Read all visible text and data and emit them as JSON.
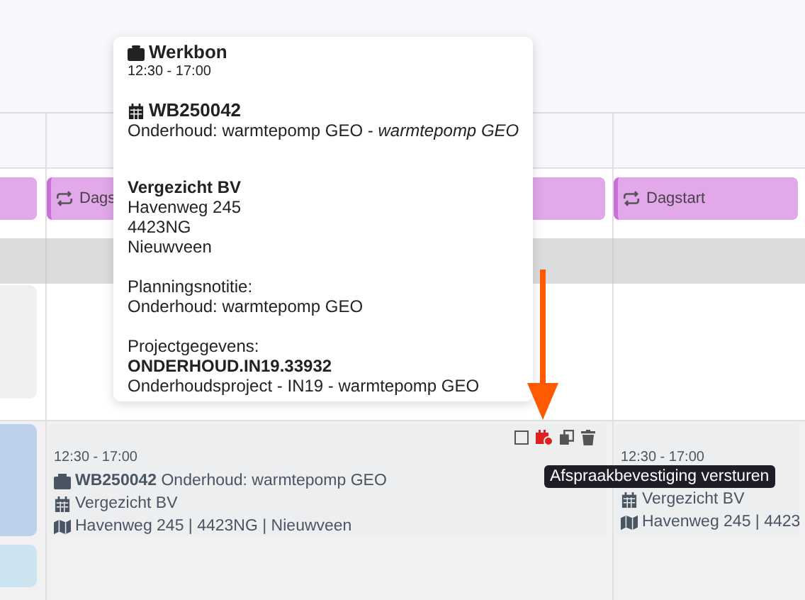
{
  "dagstart": [
    {
      "label": "Dags"
    },
    {
      "label": "Dagstart"
    }
  ],
  "popover": {
    "title": "Werkbon",
    "time": "12:30 - 17:00",
    "number": "WB250042",
    "description": "Onderhoud: warmtepomp GEO - *warmtepomp GEO*",
    "customer": "Vergezicht BV",
    "address_lines": [
      "Havenweg 245",
      "4423NG",
      "Nieuwveen"
    ],
    "note_label": "Planningsnotitie:",
    "note": "Onderhoud: warmtepomp GEO",
    "project_label": "Projectgegevens:",
    "project_code": "ONDERHOUD.IN19.33932",
    "project_name": "Onderhoudsproject - IN19 - warmtepomp GEO"
  },
  "cards": [
    {
      "time": "12:30 - 17:00",
      "number": "WB250042",
      "title": "Onderhoud: warmtepomp GEO",
      "customer": "Vergezicht BV",
      "address": "Havenweg 245 | 4423NG | Nieuwveen",
      "actions": true
    },
    {
      "time": "12:30 - 17:00",
      "customer": "Vergezicht BV",
      "address": "Havenweg 245 | 4423",
      "actions": false
    }
  ],
  "tooltip": "Afspraakbevestiging versturen"
}
